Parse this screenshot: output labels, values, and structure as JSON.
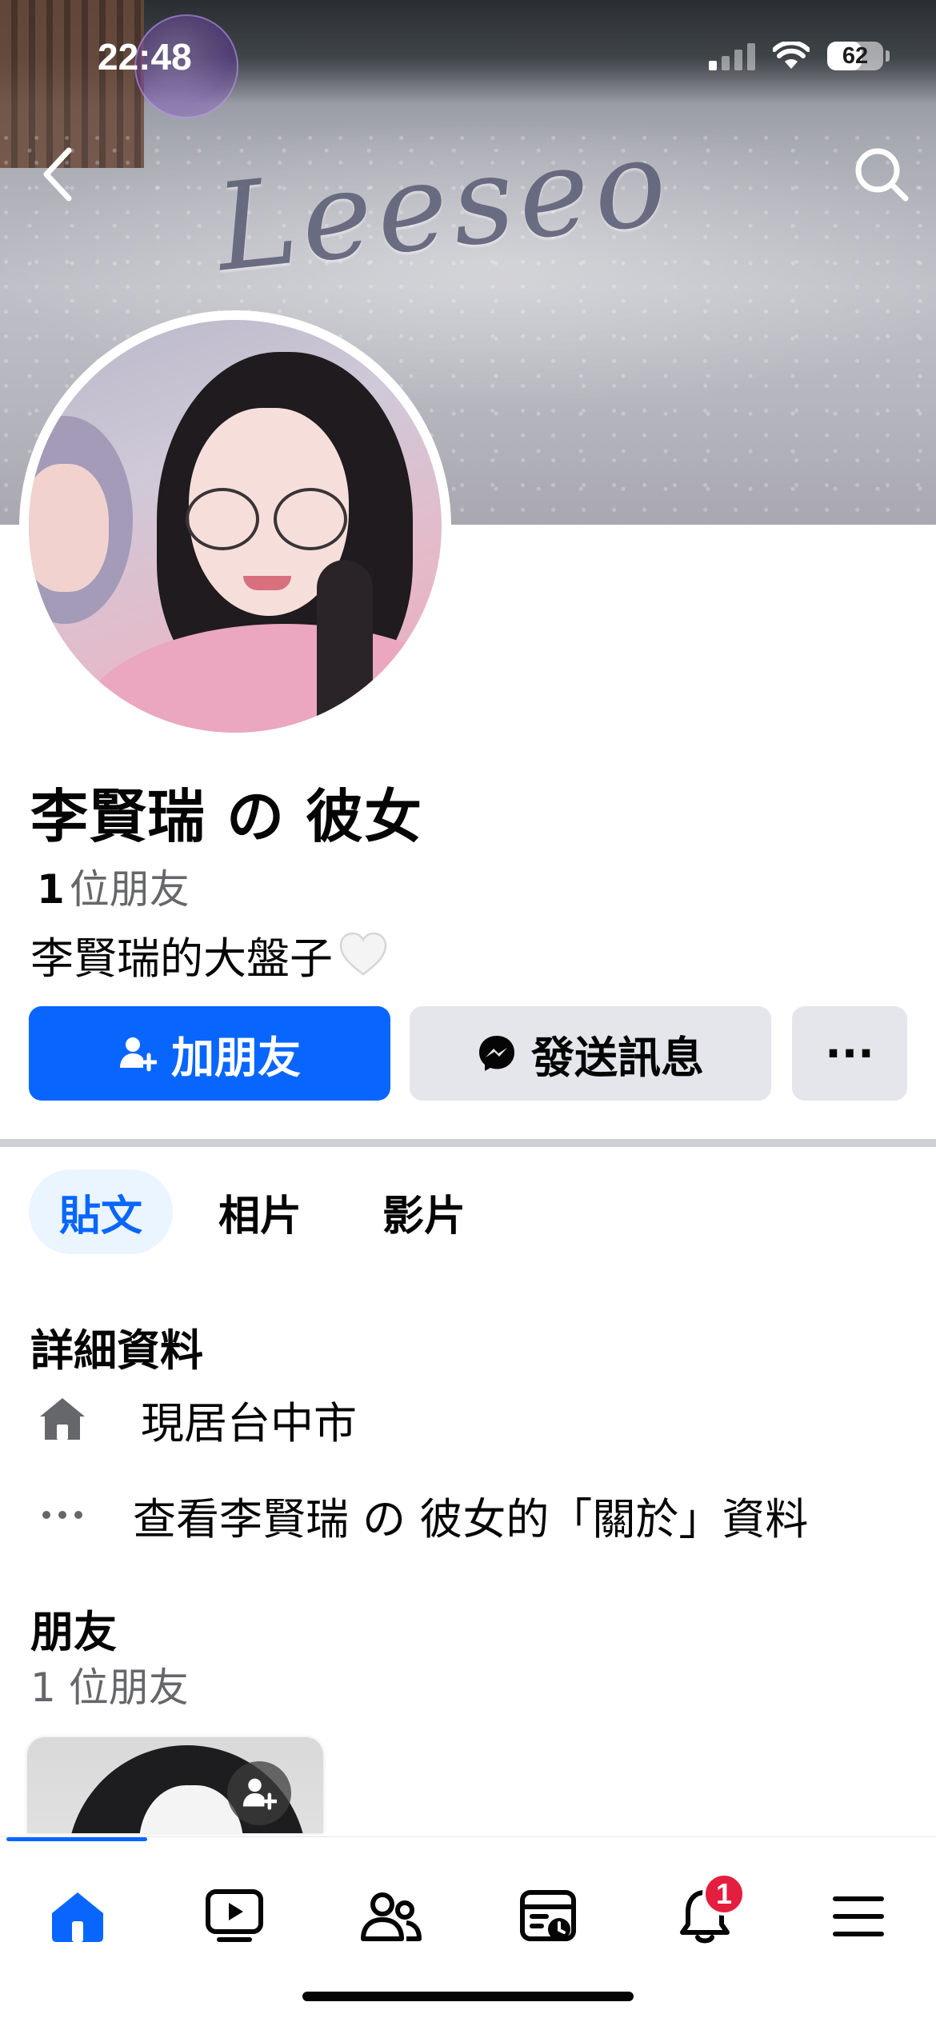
{
  "status_bar": {
    "time": "22:48",
    "battery_level": "62",
    "battery_fraction": 0.62,
    "signal_bars_active": 1,
    "wifi_icon": "wifi-icon"
  },
  "header": {
    "back_icon": "chevron-left-icon",
    "search_icon": "search-icon"
  },
  "cover": {
    "snow_text": "Leeseo"
  },
  "profile": {
    "name": "李賢瑞 の 彼女",
    "friend_count": "1",
    "friend_label": "位朋友",
    "bio": "李賢瑞的大盤子",
    "bio_emoji": "white-heart-icon"
  },
  "actions": {
    "add_friend": "加朋友",
    "send_message": "發送訊息",
    "more": "···"
  },
  "tabs": [
    {
      "label": "貼文",
      "active": true
    },
    {
      "label": "相片",
      "active": false
    },
    {
      "label": "影片",
      "active": false
    }
  ],
  "details": {
    "title": "詳細資料",
    "residence": "現居台中市",
    "about_link": "查看李賢瑞 の 彼女的「關於」資料"
  },
  "friends_section": {
    "title": "朋友",
    "count_text": "1 位朋友"
  },
  "bottom_nav": {
    "items": [
      "home-icon",
      "video-icon",
      "friends-icon",
      "marketplace-icon",
      "notifications-icon",
      "menu-icon"
    ],
    "notification_badge": "1",
    "accent": "#0866ff"
  },
  "colors": {
    "accent": "#0866ff",
    "secondary_button": "#e4e6eb",
    "badge": "#e41e3f"
  }
}
